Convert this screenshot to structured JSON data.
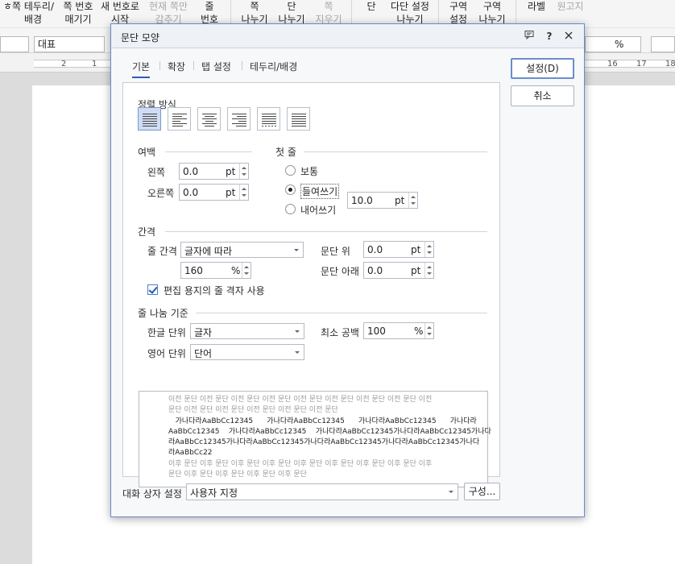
{
  "ribbon": {
    "items": [
      {
        "label": "쪽 테두리/\n배경",
        "disabled": false
      },
      {
        "label": "쪽 번호\n매기기",
        "disabled": false
      },
      {
        "label": "새 번호로\n시작",
        "disabled": false
      },
      {
        "label": "현재 쪽만\n감추기",
        "disabled": true
      },
      {
        "label": "줄\n번호",
        "disabled": false
      },
      {
        "label": "쪽\n나누기",
        "disabled": false
      },
      {
        "label": "단\n나누기",
        "disabled": false
      },
      {
        "label": "쪽\n지우기",
        "disabled": true
      },
      {
        "label": "단",
        "disabled": false
      },
      {
        "label": "다단 설정\n나누기",
        "disabled": false
      },
      {
        "label": "구역\n설정",
        "disabled": false
      },
      {
        "label": "구역\n나누기",
        "disabled": false
      },
      {
        "label": "라벨",
        "disabled": false
      },
      {
        "label": "원고지",
        "disabled": true
      }
    ]
  },
  "toolbar": {
    "style_value": "대표",
    "zoom_unit": "%"
  },
  "ruler": {
    "numbers": [
      "2",
      "1",
      "16",
      "17",
      "18"
    ]
  },
  "dialog": {
    "title": "문단 모양",
    "tabs": [
      "기본",
      "확장",
      "탭 설정",
      "테두리/배경"
    ],
    "active_tab": "기본",
    "ok_label": "설정(D)",
    "cancel_label": "취소",
    "alignment": {
      "title": "정렬 방식",
      "options": [
        "justify-icon",
        "align-left-icon",
        "align-center-icon",
        "align-right-icon",
        "distribute-icon",
        "divide-icon"
      ],
      "selected": "justify-icon"
    },
    "margin": {
      "title": "여백",
      "left_label": "왼쪽",
      "left_value": "0.0",
      "right_label": "오른쪽",
      "right_value": "0.0",
      "unit": "pt"
    },
    "first_line": {
      "title": "첫 줄",
      "normal_label": "보통",
      "indent_label": "들여쓰기",
      "hanging_label": "내어쓰기",
      "selected": "indent",
      "value": "10.0",
      "unit": "pt"
    },
    "spacing": {
      "title": "간격",
      "line_spacing_label": "줄 간격",
      "line_spacing_type": "글자에 따라",
      "line_spacing_value": "160",
      "line_spacing_unit": "%",
      "above_label": "문단 위",
      "above_value": "0.0",
      "below_label": "문단 아래",
      "below_value": "0.0",
      "unit": "pt",
      "grid_checkbox_label": "편집 용지의 줄 격자 사용",
      "grid_checked": true
    },
    "line_break": {
      "title": "줄 나눔 기준",
      "korean_label": "한글 단위",
      "korean_value": "글자",
      "english_label": "영어 단위",
      "english_value": "단어",
      "min_space_label": "최소 공백",
      "min_space_value": "100",
      "min_space_unit": "%"
    },
    "preview": {
      "prev_lines": [
        "이전 문단 이전 문단 이전 문단 이전 문단 이전 문단 이전 문단 이전 문단 이전 문단 이전",
        "문단 이전 문단 이전 문단 이전 문단 이전 문단 이전 문단"
      ],
      "current_lines": [
        "   가나다라AaBbCc12345      가나다라AaBbCc12345      가나다라AaBbCc12345      가나다라",
        "AaBbCc12345    가나다라AaBbCc12345    가나다라AaBbCc12345가나다라AaBbCc12345가나다",
        "라AaBbCc12345가나다라AaBbCc12345가나다라AaBbCc12345가나다라AaBbCc12345가나다",
        "라AaBbCc22"
      ],
      "next_lines": [
        "이후 문단 이후 문단 이후 문단 이후 문단 이후 문단 이후 문단 이후 문단 이후 문단 이후",
        "문단 이후 문단 이후 문단 이후 문단 이후 문단"
      ]
    },
    "preset": {
      "label": "대화 상자 설정",
      "value": "사용자 지정",
      "config_button": "구성..."
    }
  }
}
